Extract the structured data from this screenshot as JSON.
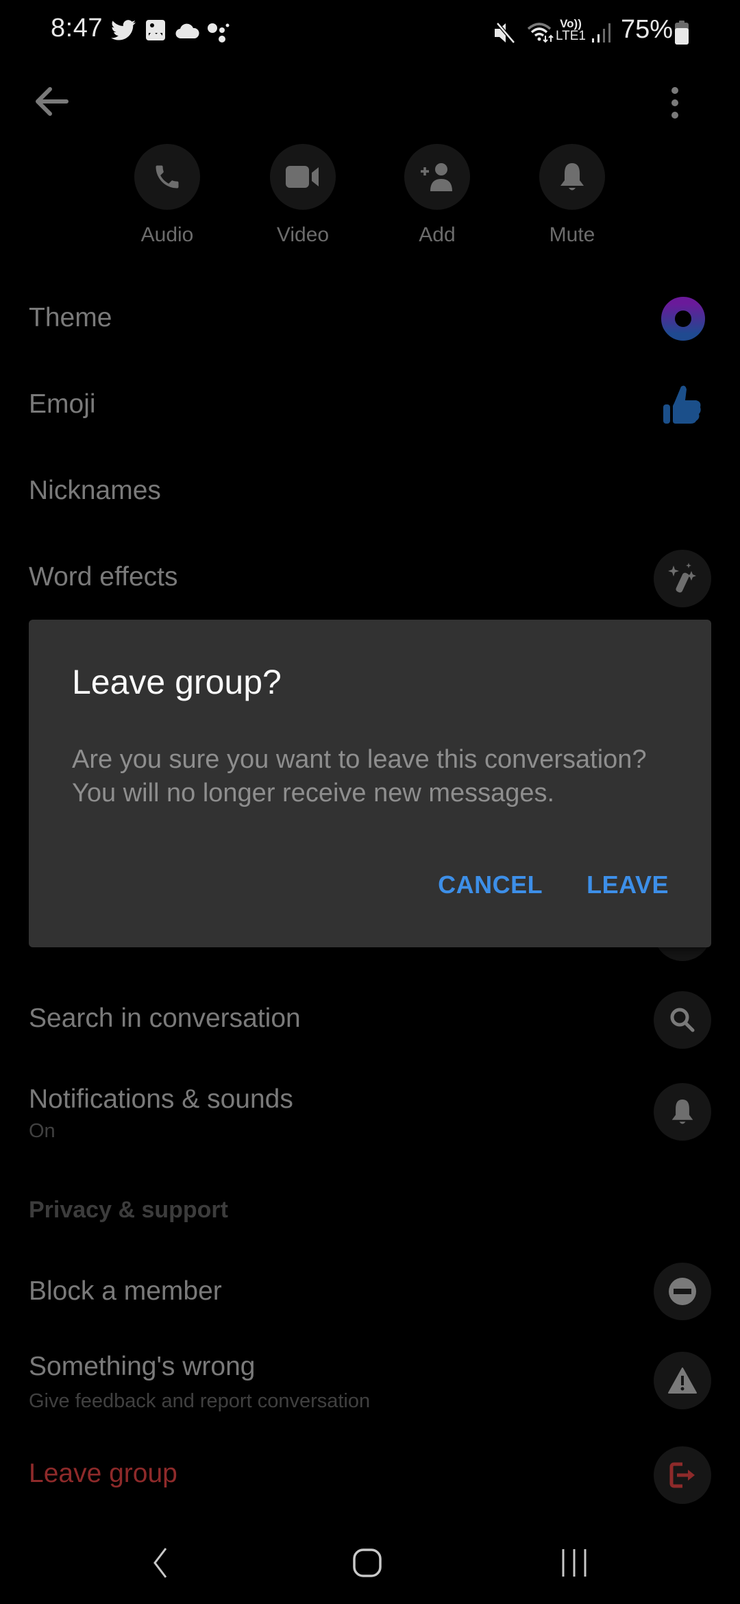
{
  "status_bar": {
    "time": "8:47",
    "notification_icons": [
      "twitter-icon",
      "gallery-icon",
      "cloud-icon",
      "assistant-dots-icon"
    ],
    "system_icons": [
      "mute-icon",
      "wifi-icon",
      "volte-lte-icon",
      "signal-icon",
      "battery-icon"
    ],
    "volte_top": "Vo))",
    "volte_bottom": "LTE1",
    "battery_percent": "75%",
    "battery_level": 0.75
  },
  "top_bar": {
    "back_icon": "arrow-left-icon",
    "more_icon": "more-vertical-icon"
  },
  "quick_actions": [
    {
      "label": "Audio",
      "icon": "phone-icon"
    },
    {
      "label": "Video",
      "icon": "video-camera-icon"
    },
    {
      "label": "Add",
      "icon": "add-person-icon"
    },
    {
      "label": "Mute",
      "icon": "bell-icon"
    }
  ],
  "settings": {
    "theme": {
      "label": "Theme",
      "icon": "theme-ring-icon"
    },
    "emoji": {
      "label": "Emoji",
      "icon": "thumbs-up-icon"
    },
    "nicknames": {
      "label": "Nicknames"
    },
    "word_effects": {
      "label": "Word effects",
      "icon": "magic-wand-icon"
    },
    "search": {
      "label": "Search in conversation",
      "icon": "search-icon"
    },
    "notifications": {
      "label": "Notifications & sounds",
      "sub": "On",
      "icon": "bell-icon"
    },
    "privacy_header": "Privacy & support",
    "block": {
      "label": "Block a member",
      "icon": "block-icon"
    },
    "something_wrong": {
      "label": "Something's wrong",
      "sub": "Give feedback and report conversation",
      "icon": "warning-icon"
    },
    "leave": {
      "label": "Leave group",
      "icon": "exit-icon"
    }
  },
  "dialog": {
    "title": "Leave group?",
    "body": "Are you sure you want to leave this conversation? You will no longer receive new messages.",
    "cancel_label": "CANCEL",
    "confirm_label": "LEAVE"
  },
  "colors": {
    "accent_blue": "#3d8fe8",
    "danger_red": "#8e2a2a",
    "theme_gradient_top": "#6a1a9a",
    "theme_gradient_bottom": "#1f4a90",
    "emoji_blue": "#1b4f8a"
  },
  "nav_bar": {
    "buttons": [
      "nav-back-icon",
      "nav-home-icon",
      "nav-recents-icon"
    ]
  }
}
